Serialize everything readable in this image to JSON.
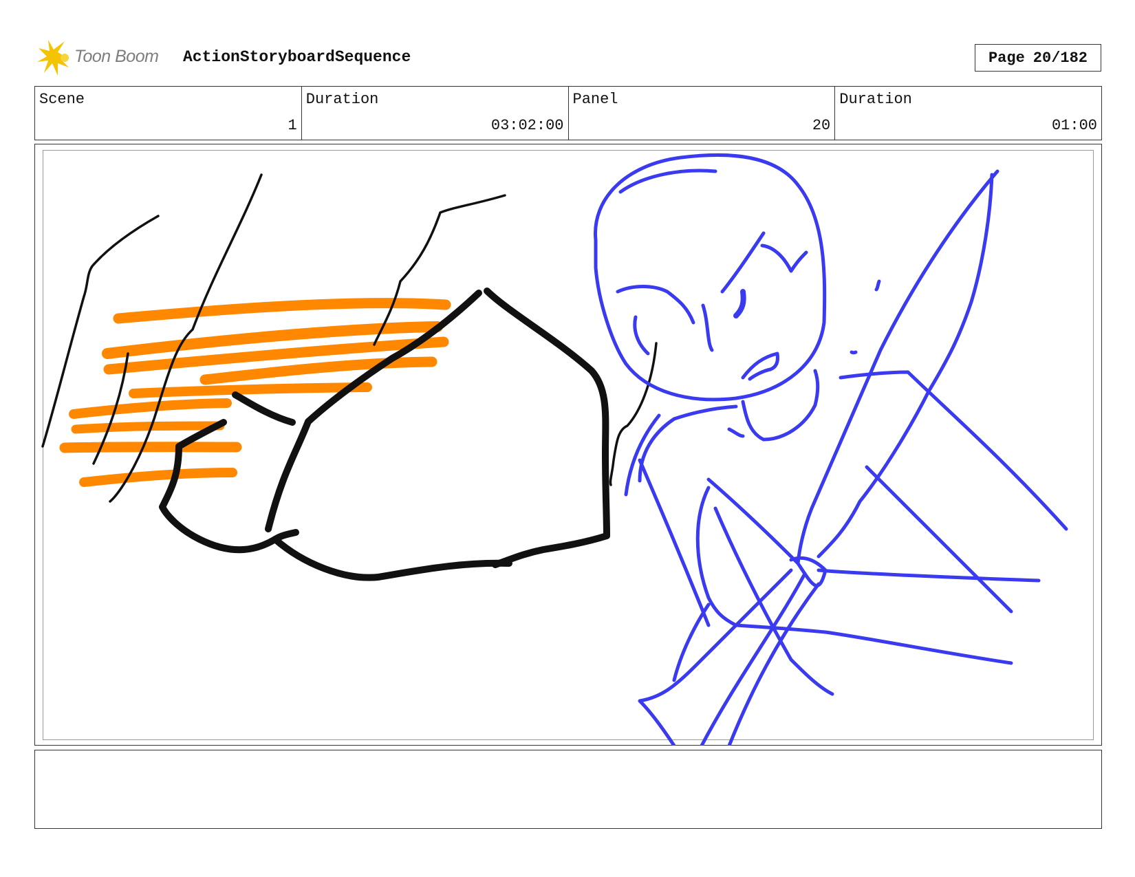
{
  "header": {
    "brand": "Toon Boom",
    "sequence_title": "ActionStoryboardSequence",
    "page_label": "Page",
    "page_value": "20/182"
  },
  "info": {
    "scene_label": "Scene",
    "scene_value": "1",
    "scene_duration_label": "Duration",
    "scene_duration_value": "03:02:00",
    "panel_label": "Panel",
    "panel_value": "20",
    "panel_duration_label": "Duration",
    "panel_duration_value": "01:00"
  },
  "colors": {
    "logo_star": "#f5c400",
    "sketch_black": "#111111",
    "sketch_orange": "#ff8800",
    "sketch_blue": "#3a3af0"
  },
  "notes": {
    "text": ""
  }
}
